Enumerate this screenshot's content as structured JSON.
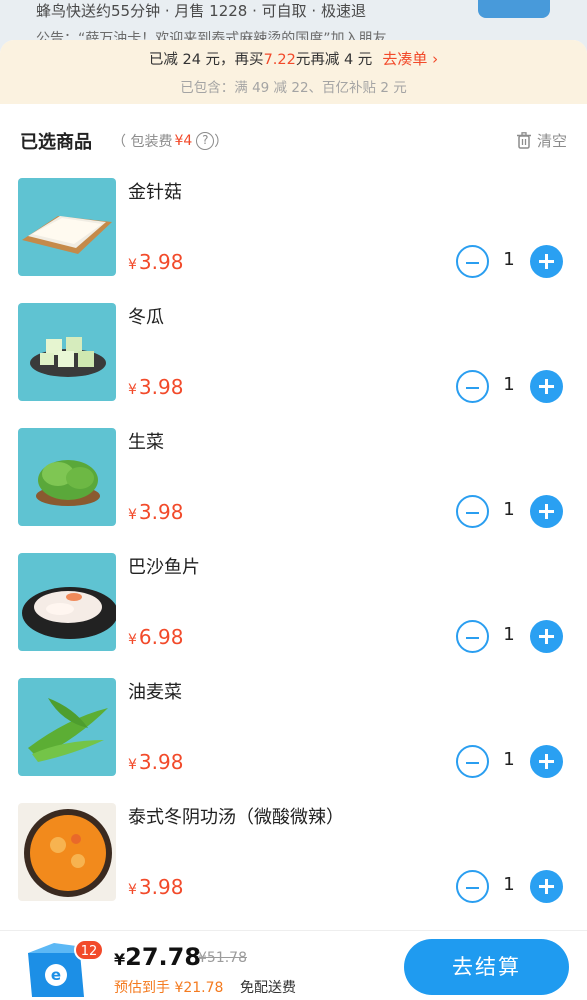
{
  "store": {
    "info": "蜂鸟快送约55分钟 · 月售 1228 · 可自取 · 极速退",
    "notice": "公告：“薛万油卡！欢迎来到泰式麻辣烫的国度”加入朋友"
  },
  "promo": {
    "prefix": "已减 24 元，再买",
    "amount": "7.22",
    "suffix": "元再减 4 元",
    "action": "去凑单 ›",
    "detail": "已包含：满 49 减 22、百亿补贴 2 元"
  },
  "selected": {
    "title": "已选商品",
    "fee_open": "（ 包装费",
    "fee_amount": "¥4",
    "fee_close": "）",
    "help": "?",
    "clear": "清空"
  },
  "items": [
    {
      "name": "金针菇",
      "yen": "¥",
      "price": "3.98",
      "qty": "1"
    },
    {
      "name": "冬瓜",
      "yen": "¥",
      "price": "3.98",
      "qty": "1"
    },
    {
      "name": "生菜",
      "yen": "¥",
      "price": "3.98",
      "qty": "1"
    },
    {
      "name": "巴沙鱼片",
      "yen": "¥",
      "price": "6.98",
      "qty": "1"
    },
    {
      "name": "油麦菜",
      "yen": "¥",
      "price": "3.98",
      "qty": "1"
    },
    {
      "name": "泰式冬阴功汤（微酸微辣）",
      "yen": "¥",
      "price": "3.98",
      "qty": "1"
    }
  ],
  "bottom": {
    "badge": "12",
    "yen": "¥",
    "total": "27.78",
    "original": "¥51.78",
    "estimate": "预估到手 ¥21.78",
    "delivery": "免配送费",
    "checkout": "去结算"
  },
  "colors": {
    "accent": "#2aa0f2",
    "price": "#f24a2a",
    "promo_bg": "#fbf2e0"
  }
}
